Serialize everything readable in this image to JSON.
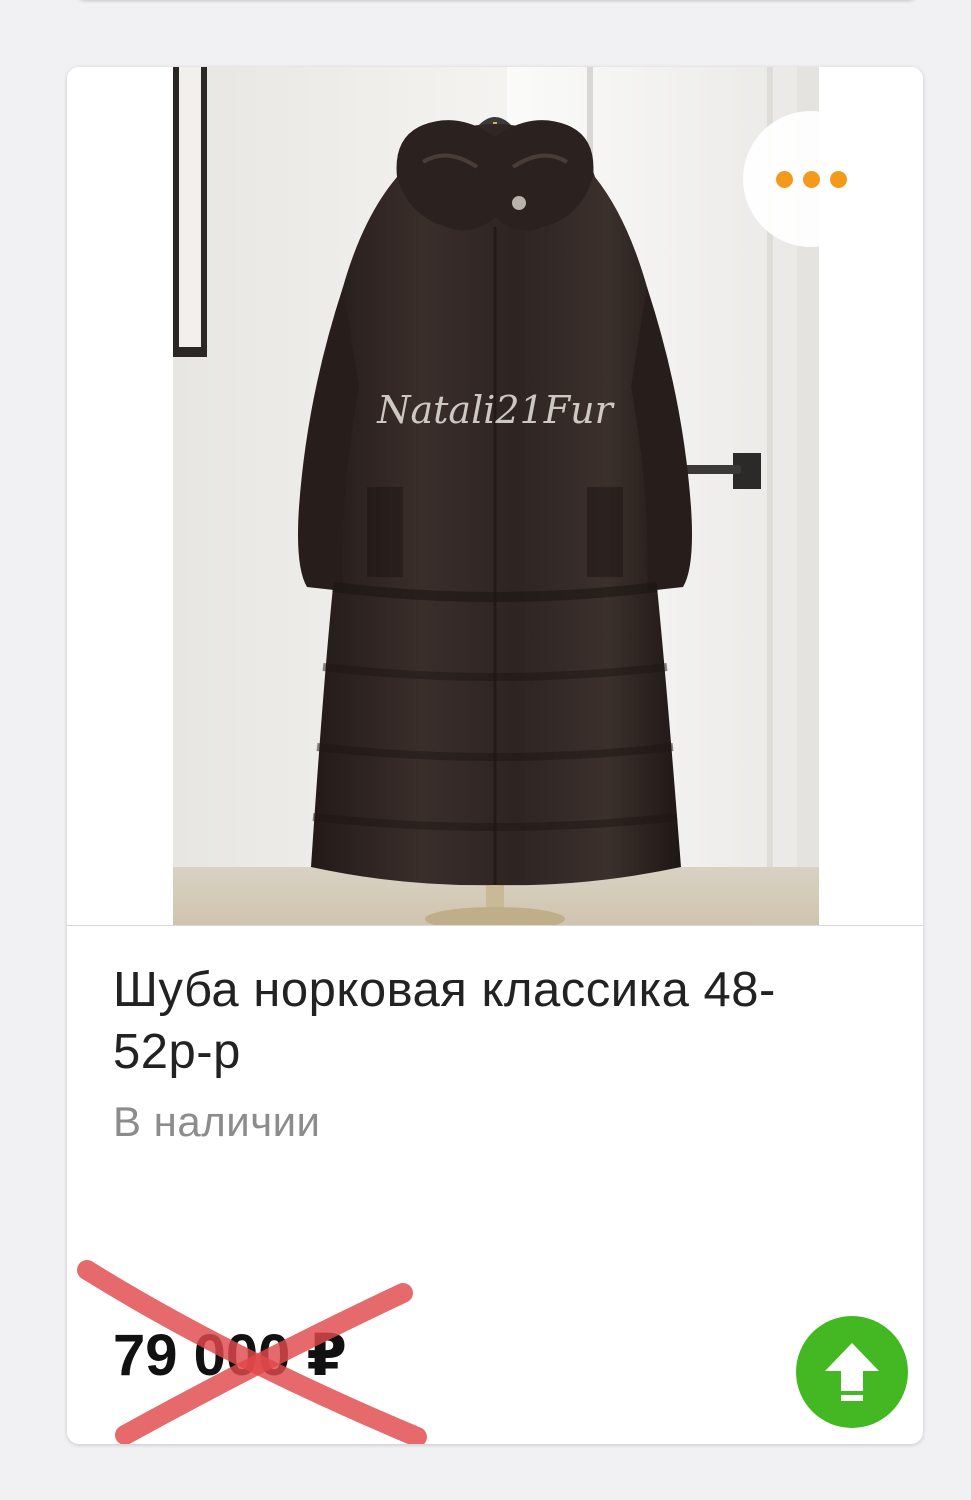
{
  "listing": {
    "image_watermark": "Natali21Fur",
    "title": "Шуба норковая классика 48-52р-р",
    "availability": "В наличии",
    "price": "79 000 ₽",
    "price_crossed_out": true
  },
  "icons": {
    "more": "more-dots-icon",
    "raise": "arrow-up-icon"
  },
  "colors": {
    "accent_orange": "#f39a1c",
    "raise_green": "#44b822",
    "cross_red": "#e0484b",
    "background": "#f1f1f4"
  }
}
